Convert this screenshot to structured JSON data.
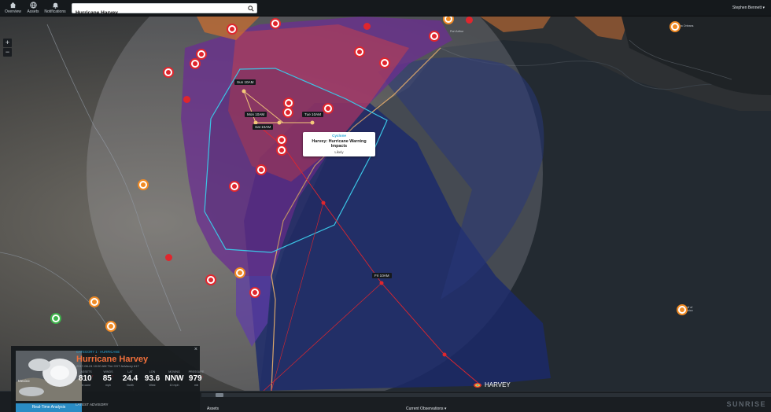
{
  "nav": {
    "overview": "Overview",
    "assets": "Assets",
    "notifications": "Notifications"
  },
  "search": {
    "value": "Hurricane Harvey"
  },
  "user": {
    "name": "Stephen Bennett ▾"
  },
  "map": {
    "zoom_in": "+",
    "zoom_out": "−",
    "track_labels": {
      "sun": "Sun 10AM",
      "mon": "Mon 10AM",
      "tue": "Tue 10AM",
      "sat": "Sat 10AM",
      "fri": "Fri 10AM"
    },
    "tooltip": {
      "type": "Cyclone",
      "title": "Harvey: Hurricane Warning Impacts",
      "likelihood": "Likely"
    },
    "storm_label": "HARVEY",
    "places": {
      "gulf": "Gulf of Mexico",
      "port_arthur": "Port Arthur",
      "new_orleans": "New Orleans"
    },
    "colors": {
      "warning": "#6a2f8f",
      "watch": "#c2404f",
      "cone": "#1b2a6b",
      "track": "#e0262d",
      "outline": "#3bc6e6",
      "pin": "#e0262d"
    }
  },
  "panel": {
    "thumb_label": "Mexico",
    "close": "×",
    "category": "CATEGORY 1 · HURRICANE",
    "name": "Hurricane Harvey",
    "advisory_time": "2017-08-24 10:00 AM The CDT Advisory #17",
    "stats": [
      {
        "label": "ASSETS",
        "value": "810",
        "unit": "in cone",
        "arrow": "↑"
      },
      {
        "label": "WINDS",
        "value": "85",
        "unit": "mph",
        "arrow": "↑"
      },
      {
        "label": "LAT",
        "value": "24.4",
        "unit": "North",
        "arrow": ""
      },
      {
        "label": "LON",
        "value": "93.6",
        "unit": "West",
        "arrow": ""
      },
      {
        "label": "MOVING",
        "value": "NNW",
        "unit": "10 mph",
        "arrow": ""
      },
      {
        "label": "PRESSURE",
        "value": "979",
        "unit": "mb",
        "arrow": "↓"
      }
    ],
    "realtime_button": "Real-Time Analysis",
    "latest_advisory": "LATEST ADVISORY"
  },
  "bottom": {
    "assets_tab": "Assets",
    "observations_tab": "Current Observations ▾",
    "brand": "SUNRISE"
  }
}
